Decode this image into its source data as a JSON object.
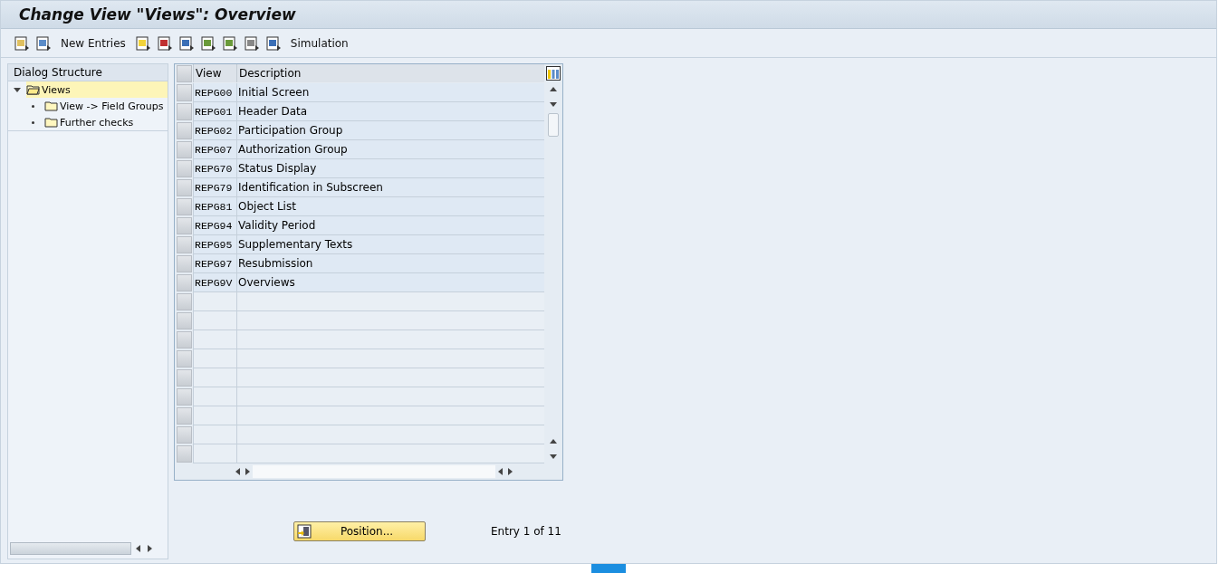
{
  "window": {
    "title": "Change View \"Views\": Overview"
  },
  "toolbar": [
    {
      "kind": "icon"
    },
    {
      "kind": "icon"
    },
    {
      "kind": "text",
      "label": "New Entries"
    },
    {
      "kind": "icon"
    },
    {
      "kind": "icon"
    },
    {
      "kind": "icon"
    },
    {
      "kind": "icon"
    },
    {
      "kind": "icon"
    },
    {
      "kind": "icon"
    },
    {
      "kind": "icon"
    },
    {
      "kind": "text",
      "label": "Simulation"
    }
  ],
  "dialog_structure": {
    "title": "Dialog Structure",
    "items": [
      {
        "label": "Views",
        "selected": true,
        "expanded": true,
        "children": [
          {
            "label": "View -> Field Groups",
            "selected": false
          },
          {
            "label": "Further checks",
            "selected": false
          }
        ]
      }
    ]
  },
  "table": {
    "columns": [
      "View",
      "Description"
    ],
    "rows": [
      {
        "view": "REPG00",
        "description": "Initial Screen"
      },
      {
        "view": "REPG01",
        "description": "Header Data"
      },
      {
        "view": "REPG02",
        "description": "Participation Group"
      },
      {
        "view": "REPG07",
        "description": "Authorization Group"
      },
      {
        "view": "REPG70",
        "description": "Status Display"
      },
      {
        "view": "REPG79",
        "description": "Identification in Subscreen"
      },
      {
        "view": "REPG81",
        "description": "Object List"
      },
      {
        "view": "REPG94",
        "description": "Validity Period"
      },
      {
        "view": "REPG95",
        "description": "Supplementary Texts"
      },
      {
        "view": "REPG97",
        "description": "Resubmission"
      },
      {
        "view": "REPG9V",
        "description": "Overviews"
      }
    ]
  },
  "position_button": "Position...",
  "entry_info": "Entry 1 of 11"
}
